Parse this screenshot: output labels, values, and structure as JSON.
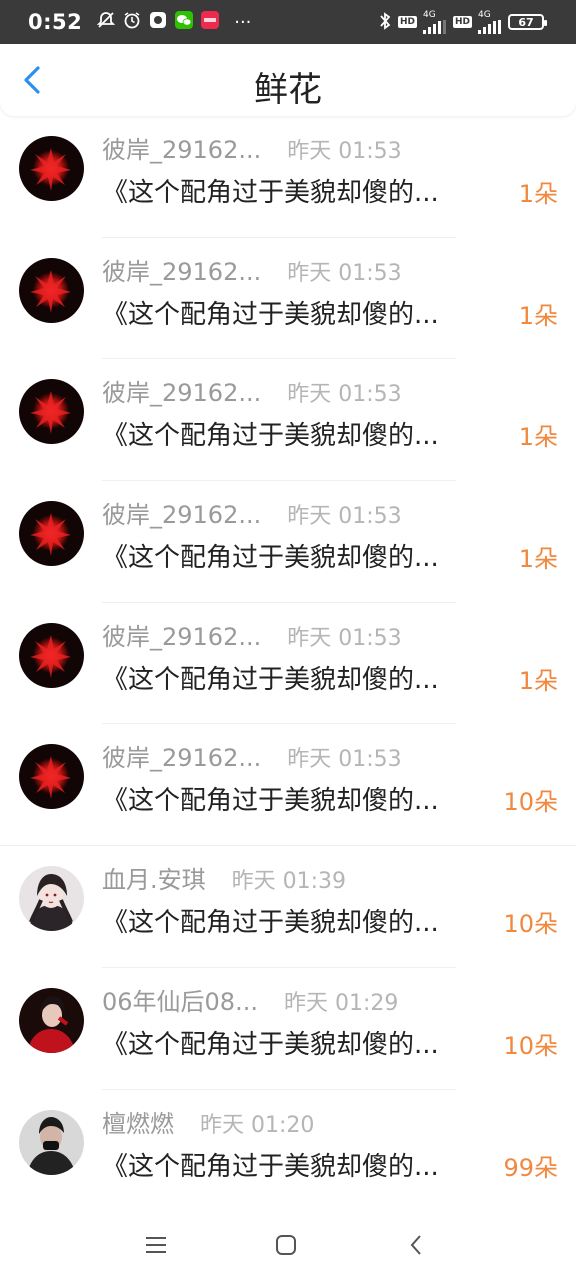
{
  "status_bar": {
    "time": "0:52",
    "more": "···",
    "network_1": "4G",
    "network_2": "4G",
    "battery": "67"
  },
  "header": {
    "title": "鲜花"
  },
  "colors": {
    "accent_blue": "#2d8ff0",
    "count_orange": "#f0883e"
  },
  "items": [
    {
      "username": "彼岸_29162...",
      "time": "昨天 01:53",
      "message": "《这个配角过于美貌却傻的...",
      "count": "1朵",
      "avatar": "red-flower"
    },
    {
      "username": "彼岸_29162...",
      "time": "昨天 01:53",
      "message": "《这个配角过于美貌却傻的...",
      "count": "1朵",
      "avatar": "red-flower"
    },
    {
      "username": "彼岸_29162...",
      "time": "昨天 01:53",
      "message": "《这个配角过于美貌却傻的...",
      "count": "1朵",
      "avatar": "red-flower"
    },
    {
      "username": "彼岸_29162...",
      "time": "昨天 01:53",
      "message": "《这个配角过于美貌却傻的...",
      "count": "1朵",
      "avatar": "red-flower"
    },
    {
      "username": "彼岸_29162...",
      "time": "昨天 01:53",
      "message": "《这个配角过于美貌却傻的...",
      "count": "1朵",
      "avatar": "red-flower"
    },
    {
      "username": "彼岸_29162...",
      "time": "昨天 01:53",
      "message": "《这个配角过于美貌却傻的...",
      "count": "10朵",
      "avatar": "red-flower"
    },
    {
      "username": "血月.安琪",
      "time": "昨天 01:39",
      "message": "《这个配角过于美貌却傻的...",
      "count": "10朵",
      "avatar": "anime-girl"
    },
    {
      "username": "06年仙后08...",
      "time": "昨天 01:29",
      "message": "《这个配角过于美貌却傻的...",
      "count": "10朵",
      "avatar": "red-portrait"
    },
    {
      "username": "檀燃燃",
      "time": "昨天 01:20",
      "message": "《这个配角过于美貌却傻的...",
      "count": "99朵",
      "avatar": "masked-person"
    }
  ]
}
